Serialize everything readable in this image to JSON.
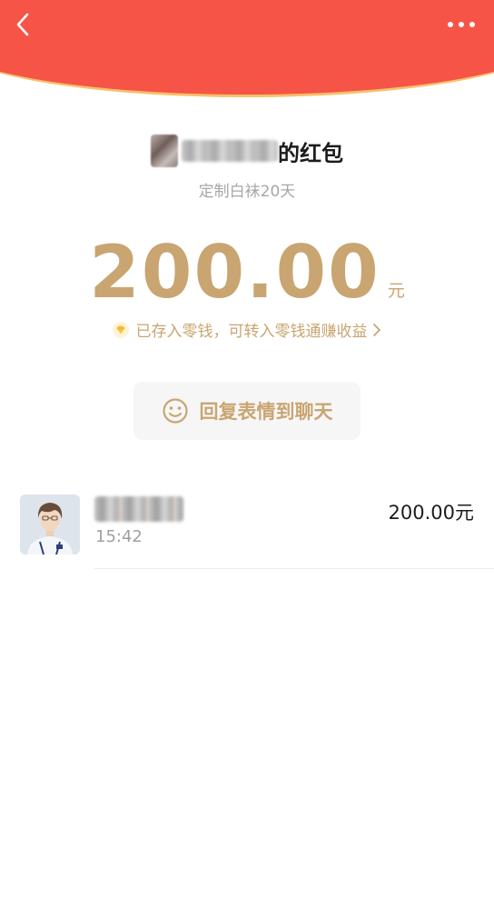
{
  "header": {
    "back_icon": "chevron-left-icon",
    "more_icon": "more-dots-icon",
    "background_color": "#f65447"
  },
  "sender": {
    "name_suffix": "的红包",
    "greeting": "定制白袜20天"
  },
  "amount": {
    "value": "200.00",
    "unit": "元",
    "color": "#c9a571"
  },
  "change_note": {
    "text": "已存入零钱，可转入零钱通赚收益",
    "icon": "diamond-icon",
    "chevron_icon": "chevron-right-icon"
  },
  "reply_button": {
    "label": "回复表情到聊天",
    "icon": "smile-icon"
  },
  "records": [
    {
      "time": "15:42",
      "amount": "200.00元"
    }
  ]
}
